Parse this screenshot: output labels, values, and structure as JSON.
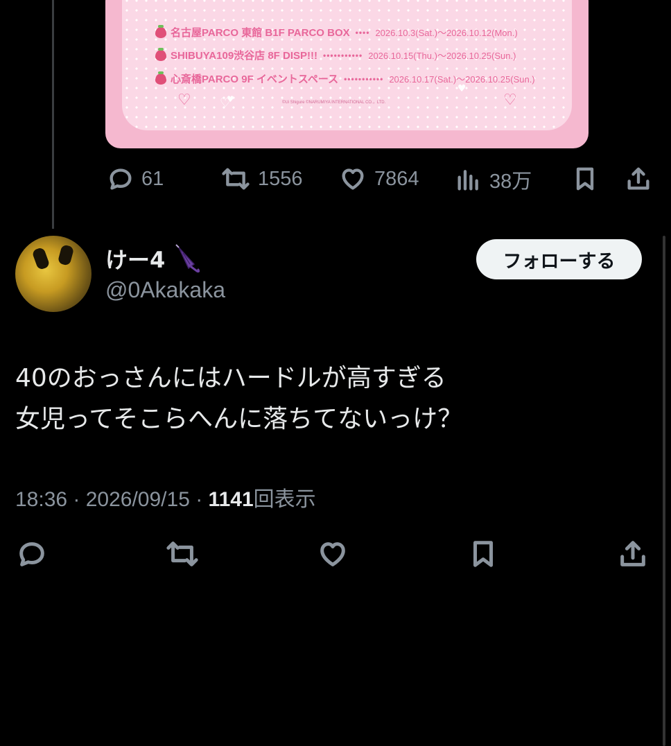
{
  "quoted_card": {
    "events": [
      {
        "name": "名古屋PARCO 東館 B1F PARCO BOX",
        "dots": "••••",
        "date": "2026.10.3(Sat.)〜2026.10.12(Mon.)"
      },
      {
        "name": "SHIBUYA109渋谷店 8F DISP!!!",
        "dots": "•••••••••••",
        "date": "2026.10.15(Thu.)〜2026.10.25(Sun.)"
      },
      {
        "name": "心斎橋PARCO 9F イベントスペース",
        "dots": "•••••••••••",
        "date": "2026.10.17(Sat.)〜2026.10.25(Sun.)"
      }
    ],
    "copyright": "©Ui Shigure ©NARUMIYA INTERNATIONAL CO.，LTD."
  },
  "parent_actions": {
    "replies": "61",
    "reposts": "1556",
    "likes": "7864",
    "views": "38万"
  },
  "tweet": {
    "display_name": "けー4",
    "handle": "@0Akakaka",
    "follow_label": "フォローする",
    "lines": [
      "40のおっさんにはハードルが高すぎる",
      "女児ってそこらへんに落ちてないっけ？"
    ],
    "time": "18:36 · 2026/09/15 · ",
    "views_count": "1141",
    "views_label": "回表示"
  },
  "colors": {
    "background": "#000000",
    "text": "#e7e9ea",
    "muted": "#8b949e",
    "card_pink": "#f5b8cf",
    "event_pink": "#e8679a"
  },
  "icons": [
    "reply-icon",
    "repost-icon",
    "like-icon",
    "views-icon",
    "bookmark-icon",
    "share-icon",
    "umbrella-icon",
    "strawberry-icon"
  ]
}
